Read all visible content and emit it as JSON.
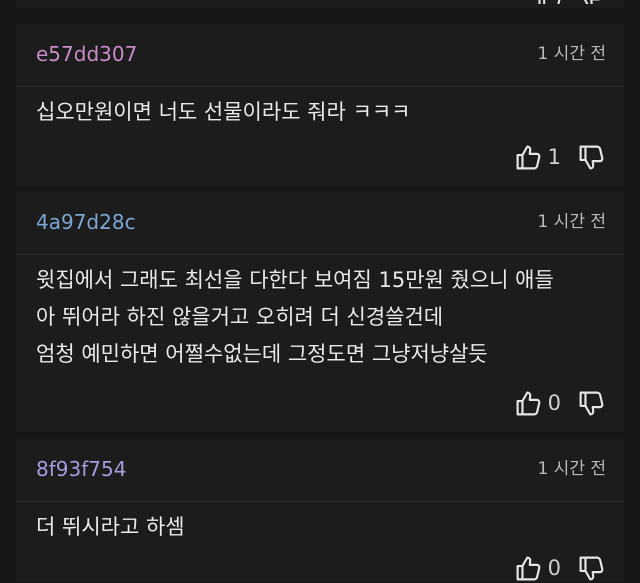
{
  "comments": [
    {
      "username": "e57dd307",
      "time": "1 시간 전",
      "body": [
        "십오만원이면 너도 선물이라도 줘라 ㅋㅋㅋ"
      ],
      "likes": "1"
    },
    {
      "username": "4a97d28c",
      "time": "1 시간 전",
      "body": [
        "윗집에서 그래도 최선을 다한다 보여짐 15만원 줬으니 애들",
        "아 뛰어라 하진 않을거고 오히려 더 신경쓸건데",
        "엄청 예민하면 어쩔수없는데 그정도면 그냥저냥살듯"
      ],
      "likes": "0"
    },
    {
      "username": "8f93f754",
      "time": "1 시간 전",
      "body": [
        "더 뛰시라고 하셈"
      ],
      "likes": "0"
    }
  ],
  "icons": {
    "like": "thumbs-up-icon",
    "dislike": "thumbs-down-icon"
  },
  "colors": {
    "background": "#161616",
    "card": "#1c1c1c",
    "text": "#e9e9e9",
    "muted": "#b9b9b9"
  }
}
